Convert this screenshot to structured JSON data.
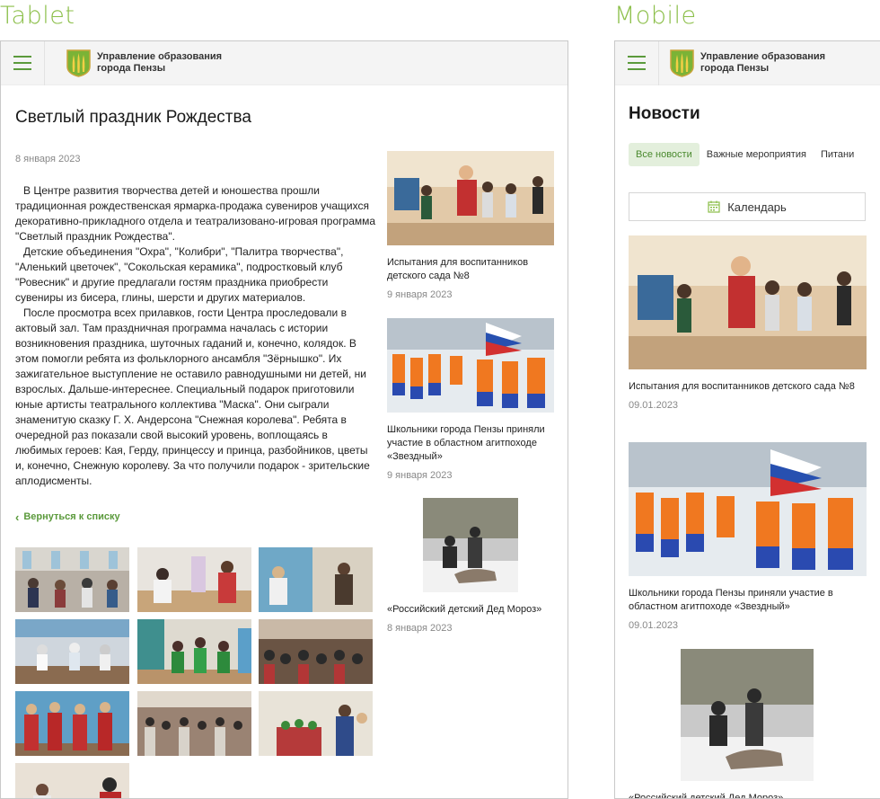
{
  "labels": {
    "tablet": "Tablet",
    "mobile": "Mobile"
  },
  "brand": {
    "line1": "Управление образования",
    "line2": "города Пензы"
  },
  "colors": {
    "accent": "#5b9a3c",
    "label": "#8cbf4a"
  },
  "article": {
    "title": "Светлый праздник Рождества",
    "date": "8 января 2023",
    "paragraphs": [
      "В Центре развития творчества детей и юношества прошли традиционная рождественская ярмарка-продажа сувениров учащихся декоративно-прикладного отдела и театрализовано-игровая программа \"Светлый праздник Рождества\".",
      "Детские объединения \"Охра\", \"Колибри\", \"Палитра творчества\", \"Аленький цветочек\", \"Сокольская керамика\", подростковый клуб \"Ровесник\" и другие предлагали гостям праздника приобрести сувениры из бисера, глины, шерсти и других материалов.",
      "После просмотра всех прилавков, гости Центра проследовали в актовый зал. Там праздничная программа началась с истории возникновения праздника, шуточных гаданий и, конечно, колядок. В этом помогли ребята из фольклорного ансамбля \"Зёрнышко\". Их зажигательное выступление не оставило равнодушными ни детей, ни взрослых. Дальше-интереснее. Специальный подарок приготовили юные артисты театрального коллектива \"Маска\". Они сыграли знаменитую сказку Г. Х. Андерсона \"Снежная королева\". Ребята в очередной раз показали свой высокий уровень, воплощаясь в любимых героев: Кая, Герду, принцессу и принца, разбойников, цветы и, конечно, Снежную королеву. За что получили подарок - зрительские аплодисменты."
    ],
    "back": "Вернуться к списку"
  },
  "side_news": [
    {
      "title": "Испытания для воспитанников детского сада №8",
      "date": "9 января 2023"
    },
    {
      "title": "Школьники города Пензы приняли участие в областном агитпоходе «Звездный»",
      "date": "9 января 2023"
    },
    {
      "title": "«Российский детский Дед Мороз»",
      "date": "8 января 2023"
    }
  ],
  "mobile": {
    "title": "Новости",
    "tabs": [
      "Все новости",
      "Важные мероприятия",
      "Питани"
    ],
    "calendar": "Календарь",
    "news": [
      {
        "title": "Испытания для воспитанников детского сада №8",
        "date": "09.01.2023"
      },
      {
        "title": "Школьники города Пензы приняли участие в областном агитпоходе «Звездный»",
        "date": "09.01.2023"
      },
      {
        "title": "«Российский детский Дед Мороз»"
      }
    ]
  }
}
